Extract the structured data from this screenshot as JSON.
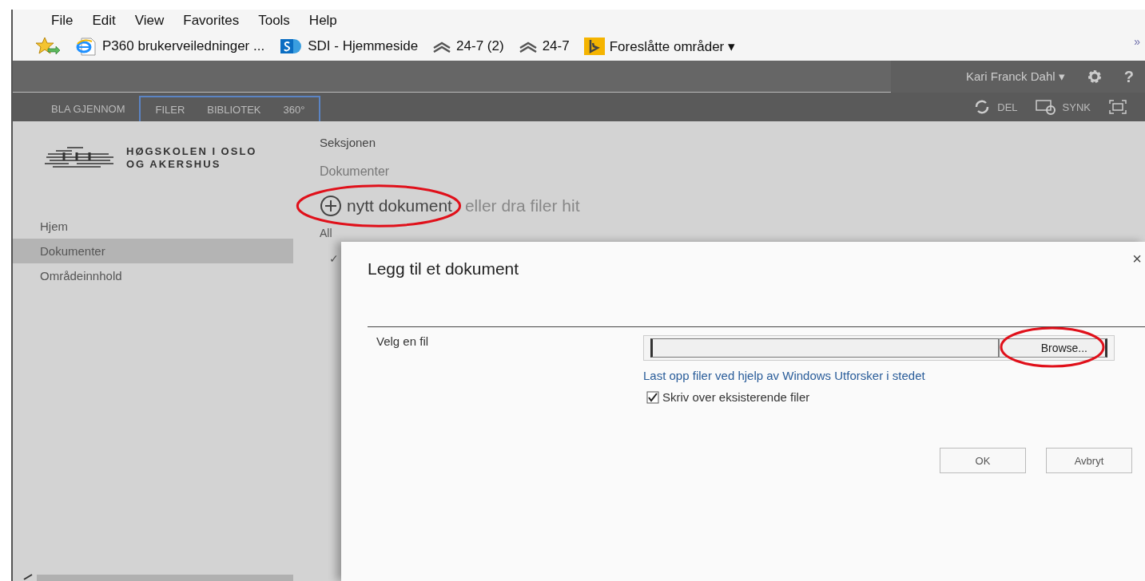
{
  "menu": [
    {
      "label": "File"
    },
    {
      "label": "Edit"
    },
    {
      "label": "View"
    },
    {
      "label": "Favorites"
    },
    {
      "label": "Tools"
    },
    {
      "label": "Help"
    }
  ],
  "favorites": {
    "items": [
      {
        "kind": "add"
      },
      {
        "kind": "page",
        "label": "P360 brukerveiledninger ..."
      },
      {
        "kind": "site",
        "label": "SDI - Hjemmeside"
      },
      {
        "kind": "chevron",
        "label": "24-7 (2)"
      },
      {
        "kind": "chevron",
        "label": "24-7"
      },
      {
        "kind": "suggest",
        "label": "Foreslåtte områder ▾"
      }
    ],
    "overflow": "»"
  },
  "suite_bar": {
    "user": "Kari Franck Dahl ▾",
    "help": "?"
  },
  "ribbon": {
    "tab_groups": [
      {
        "outlined": false,
        "tabs": [
          "BLA GJENNOM"
        ]
      },
      {
        "outlined": true,
        "tabs": [
          "FILER",
          "BIBLIOTEK",
          "360°"
        ]
      }
    ],
    "actions": [
      {
        "kind": "share",
        "label": "DEL"
      },
      {
        "kind": "sync",
        "label": "SYNK"
      },
      {
        "kind": "focus"
      }
    ]
  },
  "logo": {
    "lines": [
      "HØGSKOLEN I OSLO",
      "OG AKERSHUS"
    ]
  },
  "nav": {
    "items": [
      {
        "label": "Hjem",
        "selected": false
      },
      {
        "label": "Dokumenter",
        "selected": true
      },
      {
        "label": "Områdeinnhold",
        "selected": false
      }
    ]
  },
  "main": {
    "breadcrumb": [
      "Seksjonen",
      "Dokumenter"
    ],
    "new_document": "nytt dokument",
    "drag_hint": "eller dra filer hit",
    "view_label": "All",
    "check_mark": "✓"
  },
  "dialog": {
    "title": "Legg til et dokument",
    "close": "×",
    "file_label": "Velg en fil",
    "browse": "Browse...",
    "link": "Last opp filer ved hjelp av Windows Utforsker i stedet",
    "overwrite": {
      "label": "Skriv over eksisterende filer",
      "checked": true
    },
    "buttons": [
      "OK",
      "Avbryt"
    ]
  }
}
